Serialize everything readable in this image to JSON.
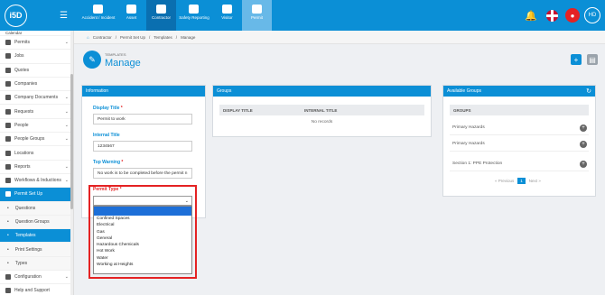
{
  "topbar": {
    "logo": "i5D",
    "tabs": [
      {
        "label": "Accident / Incident"
      },
      {
        "label": "Asset"
      },
      {
        "label": "Contractor"
      },
      {
        "label": "Safety Reporting"
      },
      {
        "label": "Visitor"
      },
      {
        "label": "Permit"
      }
    ],
    "avatar": "HD"
  },
  "sidebar": {
    "items": [
      {
        "label": "Calendar"
      },
      {
        "label": "Permits"
      },
      {
        "label": "Jobs"
      },
      {
        "label": "Quotes"
      },
      {
        "label": "Companies"
      },
      {
        "label": "Company Documents"
      },
      {
        "label": "Requests"
      },
      {
        "label": "People"
      },
      {
        "label": "People Groups"
      },
      {
        "label": "Locations"
      },
      {
        "label": "Reports"
      },
      {
        "label": "Workflows & Inductions"
      },
      {
        "label": "Permit Set Up"
      },
      {
        "label": "Questions"
      },
      {
        "label": "Question Groups"
      },
      {
        "label": "Templates"
      },
      {
        "label": "Print Settings"
      },
      {
        "label": "Types"
      },
      {
        "label": "Configuration"
      },
      {
        "label": "Help and Support"
      }
    ]
  },
  "breadcrumb": {
    "items": [
      "Contractor",
      "Permit Set Up",
      "Templates",
      "Manage"
    ]
  },
  "header": {
    "subtitle": "TEMPLATES",
    "title": "Manage"
  },
  "information": {
    "title": "Information",
    "display_title_label": "Display Title",
    "display_title_value": "Permit to work",
    "internal_title_label": "Internal Title",
    "internal_title_value": "1234567",
    "top_warning_label": "Top Warning",
    "top_warning_value": "No work is to be completed before the permit n",
    "permit_type_label": "Permit Type",
    "required_mark": "*",
    "permit_type_value": "",
    "permit_type_options": [
      "Confined Spaces",
      "Electrical",
      "Gas",
      "General",
      "Hazardous Chemicals",
      "Hot Work",
      "Water",
      "Working at Heights"
    ]
  },
  "groups": {
    "title": "Groups",
    "col_display": "DISPLAY TITLE",
    "col_internal": "INTERNAL TITLE",
    "empty": "No records"
  },
  "available_groups": {
    "title": "Available Groups",
    "col": "GROUPS",
    "rows": [
      "Primary Hazards",
      "Primary Hazards",
      "Section 1: PPE Protection"
    ],
    "pagination": {
      "previous": "Previous",
      "page": "1",
      "next": "Next"
    }
  },
  "colors": {
    "accent": "#0b8fd6",
    "highlight": "#e42223"
  }
}
